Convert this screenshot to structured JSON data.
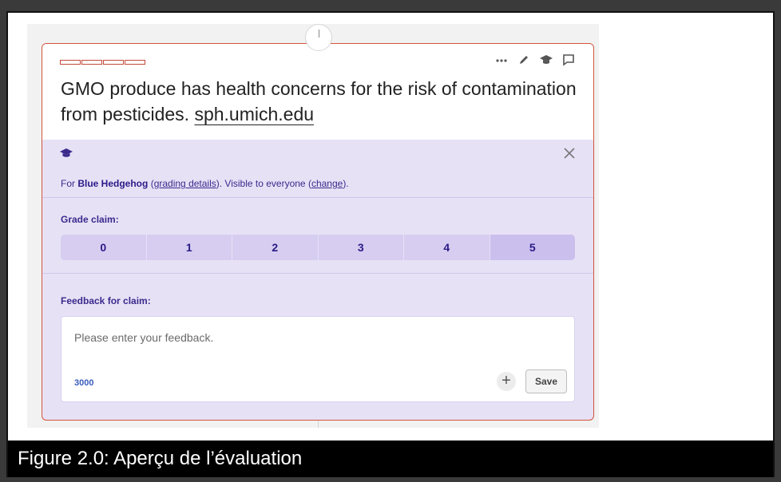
{
  "claim": {
    "text": "GMO produce has health concerns for the risk of contamination from pesticides.",
    "source": "sph.umich.edu"
  },
  "toolbar": {
    "icons": [
      "more-icon",
      "edit-icon",
      "grade-cap-icon",
      "comment-icon"
    ],
    "more_label": "•••"
  },
  "grading_panel": {
    "for_prefix": "For ",
    "grader_name": "Blue Hedgehog",
    "paren_open": " (",
    "details_link": "grading details",
    "visibility_text": "). Visible to everyone (",
    "change_link": "change",
    "paren_close": ").",
    "grade_label": "Grade claim:",
    "grades": [
      "0",
      "1",
      "2",
      "3",
      "4",
      "5"
    ],
    "feedback_label": "Feedback for claim:",
    "feedback_placeholder": "Please enter your feedback.",
    "char_count": "3000",
    "plus_label": "+",
    "save_label": "Save"
  },
  "caption": "Figure 2.0: Aperçu de l’évaluation",
  "colors": {
    "card_border": "#d2553a",
    "panel_bg": "#e7e1f6",
    "grade_bg": "#d6cdf0",
    "accent_text": "#3a2a8c"
  }
}
